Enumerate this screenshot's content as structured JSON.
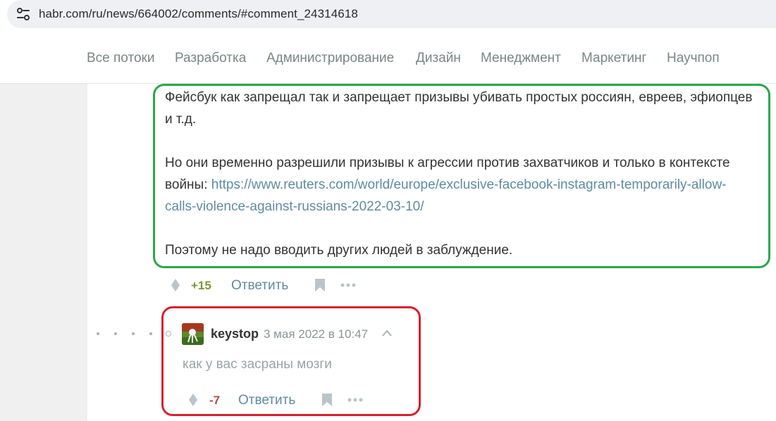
{
  "browser": {
    "url": "habr.com/ru/news/664002/comments/#comment_24314618",
    "site_info_icon": "tune-icon"
  },
  "nav": {
    "items": [
      "Все потоки",
      "Разработка",
      "Администрирование",
      "Дизайн",
      "Менеджмент",
      "Маркетинг",
      "Научпоп"
    ]
  },
  "comment": {
    "paragraph1": "Фейсбук как запрещал так и запрещает призывы убивать простых россиян, евреев, эфиопцев и т.д.",
    "paragraph2_text": "Но они временно разрешили призывы к агрессии против захватчиков и только в контексте войны: ",
    "paragraph2_link": "https://www.reuters.com/world/europe/exclusive-facebook-instagram-temporarily-allow-calls-violence-against-russians-2022-03-10/",
    "paragraph3": "Поэтому не надо вводить других людей в заблуждение.",
    "score": "+15",
    "score_color": "#7b9a2d",
    "reply_label": "Ответить",
    "highlight_color": "#2aa84a"
  },
  "reply": {
    "username": "keystop",
    "timestamp": "3 мая 2022 в 10:47",
    "text": "как у вас засраны мозги",
    "score": "-7",
    "score_color": "#b24a48",
    "reply_label": "Ответить",
    "highlight_color": "#d6202f"
  },
  "colors": {
    "link": "#5e8ba1",
    "nav_text": "#7b8588",
    "gutter": "#f0f0f0"
  }
}
